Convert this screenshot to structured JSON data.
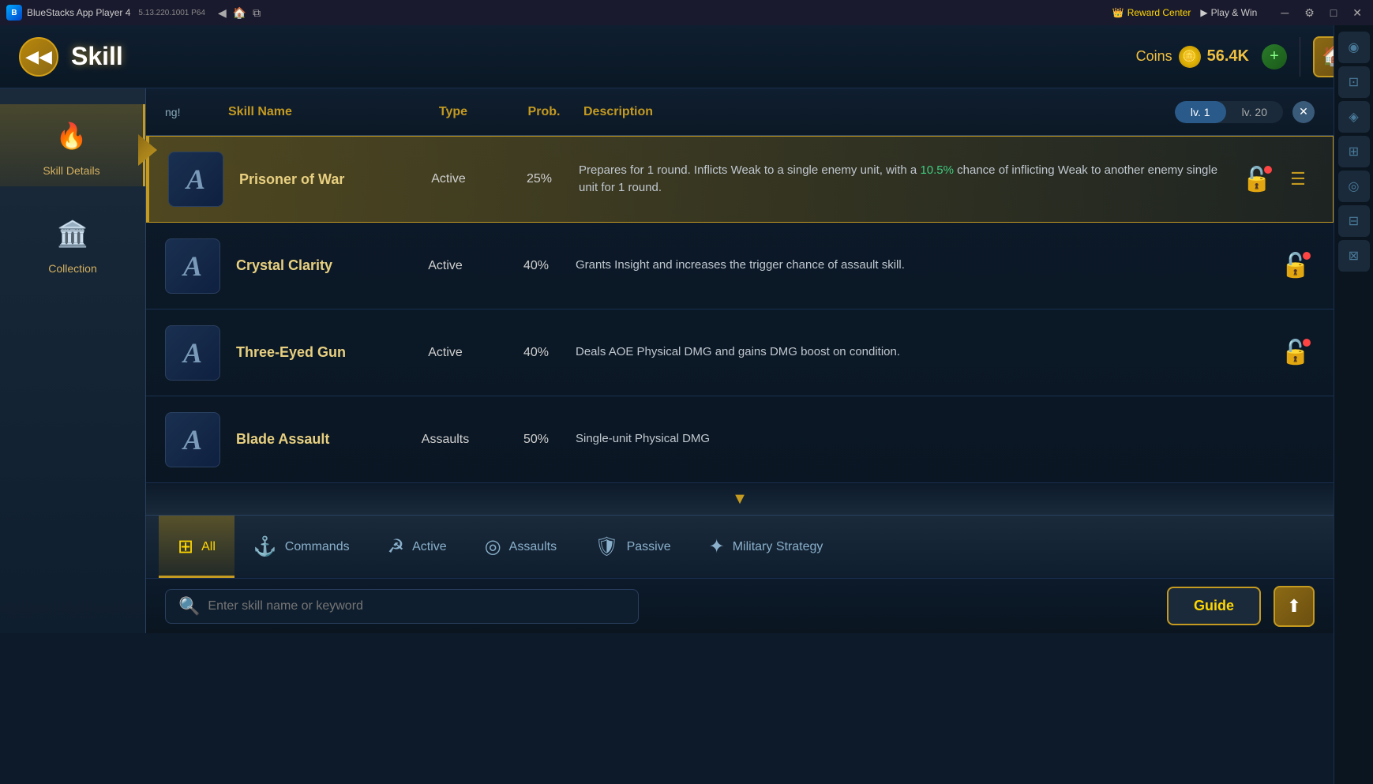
{
  "titlebar": {
    "app_name": "BlueStacks App Player 4",
    "version": "5.13.220.1001 P64",
    "reward_center": "Reward Center",
    "play_win": "Play & Win"
  },
  "header": {
    "title": "Skill",
    "coins_label": "Coins",
    "coins_amount": "56.4K"
  },
  "sidebar": {
    "items": [
      {
        "label": "Skill Details",
        "icon": "🔥"
      },
      {
        "label": "Collection",
        "icon": "🏛️"
      }
    ]
  },
  "skills_table": {
    "headers": {
      "skill_name": "Skill Name",
      "type": "Type",
      "prob": "Prob.",
      "description": "Description",
      "level_low": "lv. 1",
      "level_high": "lv. 20"
    },
    "loading_text": "ng!"
  },
  "skills": [
    {
      "id": "prisoner-of-war",
      "icon": "A",
      "name": "Prisoner of War",
      "type": "Active",
      "prob": "25%",
      "description": "Prepares for 1 round. Inflicts Weak to a single enemy unit, with a ",
      "highlight": "10.5%",
      "description_after": " chance of inflicting Weak to another enemy single unit for 1 round.",
      "locked": true,
      "highlighted": true,
      "has_menu": true
    },
    {
      "id": "crystal-clarity",
      "icon": "A",
      "name": "Crystal Clarity",
      "type": "Active",
      "prob": "40%",
      "description": "Grants Insight and increases the trigger chance of assault skill.",
      "highlight": "",
      "description_after": "",
      "locked": true,
      "highlighted": false,
      "has_menu": false
    },
    {
      "id": "three-eyed-gun",
      "icon": "A",
      "name": "Three-Eyed Gun",
      "type": "Active",
      "prob": "40%",
      "description": "Deals AOE Physical DMG and gains DMG boost on condition.",
      "highlight": "",
      "description_after": "",
      "locked": true,
      "highlighted": false,
      "has_menu": false
    },
    {
      "id": "blade-assault",
      "icon": "A",
      "name": "Blade Assault",
      "type": "Assaults",
      "prob": "50%",
      "description": "Single-unit Physical DMG",
      "highlight": "",
      "description_after": "",
      "locked": false,
      "highlighted": false,
      "has_menu": false
    }
  ],
  "tabs": [
    {
      "id": "all",
      "label": "All",
      "icon": "⊞",
      "active": true
    },
    {
      "id": "commands",
      "label": "Commands",
      "icon": "⚓"
    },
    {
      "id": "active",
      "label": "Active",
      "icon": "☭"
    },
    {
      "id": "assaults",
      "label": "Assaults",
      "icon": "◎"
    },
    {
      "id": "passive",
      "label": "Passive",
      "icon": "🛡"
    },
    {
      "id": "military-strategy",
      "label": "Military Strategy",
      "icon": "✦"
    }
  ],
  "search": {
    "placeholder": "Enter skill name or keyword"
  },
  "buttons": {
    "guide": "Guide",
    "share_icon": "⬆"
  }
}
